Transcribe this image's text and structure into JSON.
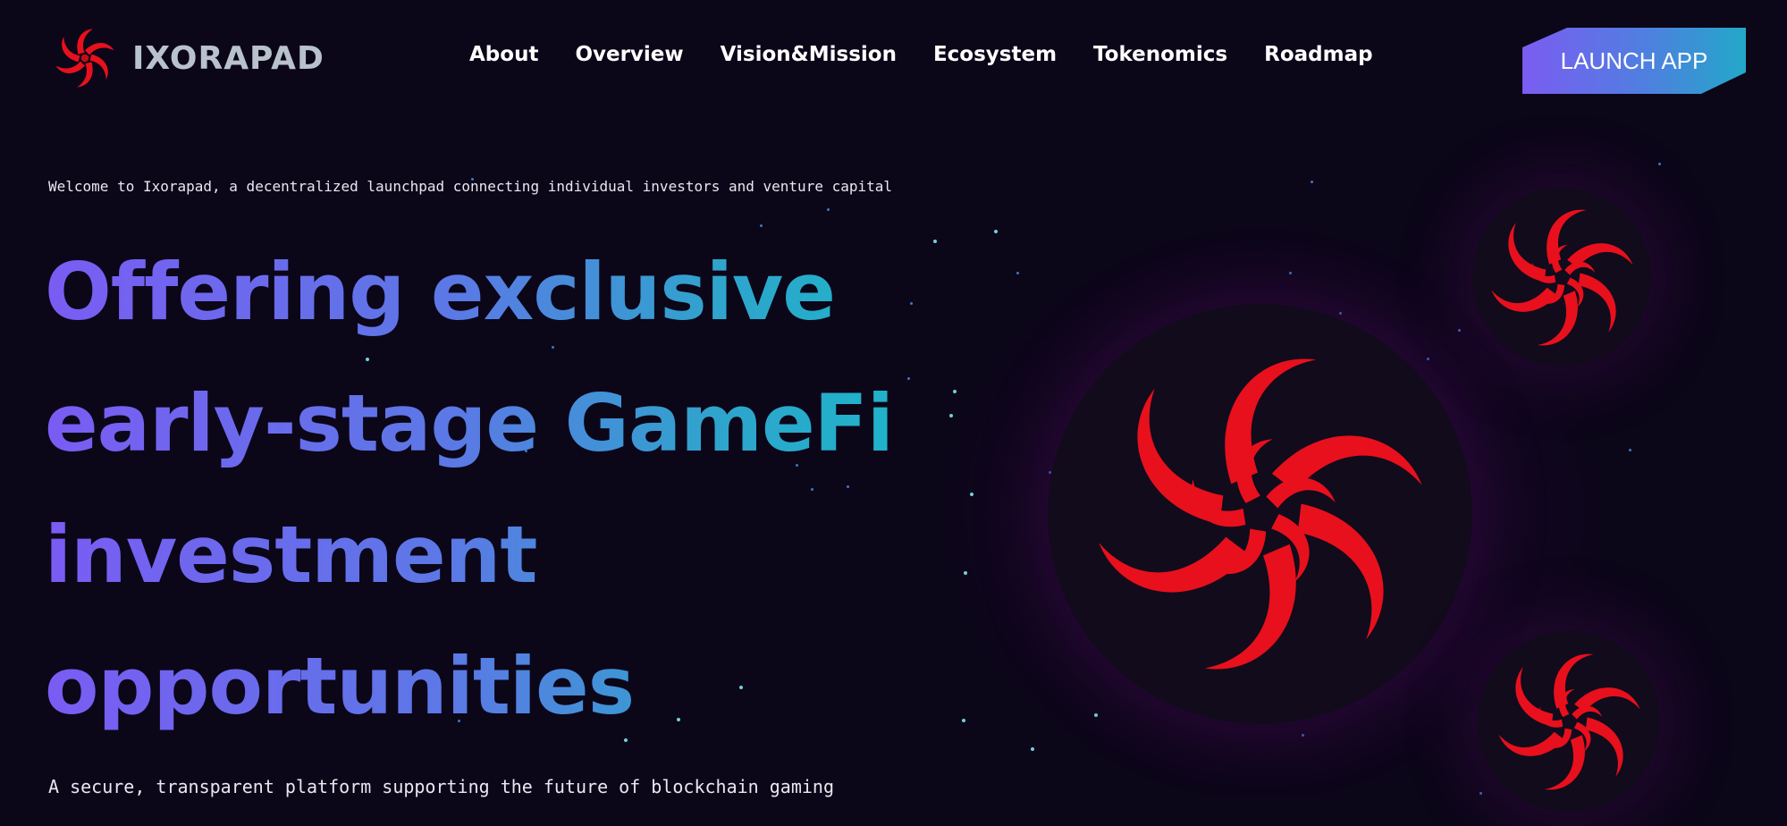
{
  "brand": {
    "name": "IXORAPAD",
    "logo_icon": "flower-swirl-logo-icon",
    "logo_color": "#e8101c"
  },
  "nav": {
    "items": [
      {
        "label": "About"
      },
      {
        "label": "Overview"
      },
      {
        "label": "Vision&Mission"
      },
      {
        "label": "Ecosystem"
      },
      {
        "label": "Tokenomics"
      },
      {
        "label": "Roadmap"
      }
    ]
  },
  "header": {
    "launch_label": "LAUNCH APP"
  },
  "hero": {
    "welcome": "Welcome to Ixorapad, a decentralized launchpad connecting individual investors and venture capital",
    "headline_lines": [
      "Offering exclusive",
      "early-stage GameFi",
      "investment",
      "opportunities"
    ],
    "tagline": "A secure, transparent platform supporting the future of blockchain gaming"
  },
  "colors": {
    "background": "#0c0619",
    "accent_purple": "#7a5cf3",
    "accent_cyan": "#1ab7c9",
    "logo_red": "#e8101c"
  }
}
